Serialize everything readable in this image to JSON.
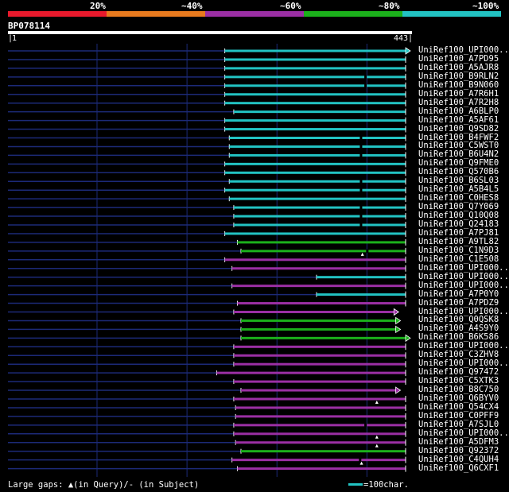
{
  "legend": {
    "labels": [
      "20%",
      "~40%",
      "~60%",
      "~80%",
      "~100%"
    ],
    "colors": [
      "#e8192c",
      "#e87a1e",
      "#9b2fa4",
      "#1bb01b",
      "#22c3c3"
    ]
  },
  "query": {
    "id": "BP078114",
    "start": "1",
    "end": "443",
    "length": 443
  },
  "colors": {
    "cyan": "#22c3c3",
    "purple": "#9b2fa4",
    "green": "#1bb01b",
    "navy": "#1c2a78",
    "grid": "#1c2a78"
  },
  "hits": [
    {
      "label": "UniRef100_UPI000...",
      "start": 242,
      "end": 443,
      "color": "cyan",
      "arrow": true
    },
    {
      "label": "UniRef100_A7PD95",
      "start": 242,
      "end": 443,
      "color": "cyan",
      "arrow": false
    },
    {
      "label": "UniRef100_A5AJR8",
      "start": 242,
      "end": 443,
      "color": "cyan",
      "arrow": false
    },
    {
      "label": "UniRef100_B9RLN2",
      "start": 242,
      "end": 443,
      "color": "cyan",
      "arrow": false,
      "gaps": [
        {
          "pos": 398,
          "type": "subject"
        }
      ]
    },
    {
      "label": "UniRef100_B9N060",
      "start": 242,
      "end": 443,
      "color": "cyan",
      "arrow": false,
      "gaps": [
        {
          "pos": 398,
          "type": "subject"
        }
      ]
    },
    {
      "label": "UniRef100_A7R6H1",
      "start": 242,
      "end": 443,
      "color": "cyan",
      "arrow": false
    },
    {
      "label": "UniRef100_A7R2H8",
      "start": 242,
      "end": 443,
      "color": "cyan",
      "arrow": false
    },
    {
      "label": "UniRef100_A6BLP0",
      "start": 252,
      "end": 443,
      "color": "cyan",
      "arrow": false
    },
    {
      "label": "UniRef100_A5AF61",
      "start": 242,
      "end": 443,
      "color": "cyan",
      "arrow": false
    },
    {
      "label": "UniRef100_Q9SD82",
      "start": 242,
      "end": 443,
      "color": "cyan",
      "arrow": false
    },
    {
      "label": "UniRef100_B4FWF2",
      "start": 247,
      "end": 443,
      "color": "cyan",
      "arrow": false,
      "gaps": [
        {
          "pos": 393,
          "type": "subject"
        }
      ]
    },
    {
      "label": "UniRef100_C5WST0",
      "start": 247,
      "end": 443,
      "color": "cyan",
      "arrow": false,
      "gaps": [
        {
          "pos": 393,
          "type": "subject"
        }
      ]
    },
    {
      "label": "UniRef100_B6U4N2",
      "start": 247,
      "end": 443,
      "color": "cyan",
      "arrow": false,
      "gaps": [
        {
          "pos": 393,
          "type": "subject"
        }
      ]
    },
    {
      "label": "UniRef100_Q9FME0",
      "start": 242,
      "end": 443,
      "color": "cyan",
      "arrow": false
    },
    {
      "label": "UniRef100_Q570B6",
      "start": 242,
      "end": 443,
      "color": "cyan",
      "arrow": false
    },
    {
      "label": "UniRef100_B6SL03",
      "start": 247,
      "end": 443,
      "color": "cyan",
      "arrow": false,
      "gaps": [
        {
          "pos": 393,
          "type": "subject"
        }
      ]
    },
    {
      "label": "UniRef100_A5B4L5",
      "start": 242,
      "end": 443,
      "color": "cyan",
      "arrow": false,
      "gaps": [
        {
          "pos": 393,
          "type": "subject"
        }
      ]
    },
    {
      "label": "UniRef100_C0HES8",
      "start": 247,
      "end": 443,
      "color": "cyan",
      "arrow": false
    },
    {
      "label": "UniRef100_Q7Y069",
      "start": 252,
      "end": 443,
      "color": "cyan",
      "arrow": false,
      "gaps": [
        {
          "pos": 393,
          "type": "subject"
        }
      ]
    },
    {
      "label": "UniRef100_Q10Q08",
      "start": 252,
      "end": 443,
      "color": "cyan",
      "arrow": false,
      "gaps": [
        {
          "pos": 393,
          "type": "subject"
        }
      ]
    },
    {
      "label": "UniRef100_Q24183",
      "start": 252,
      "end": 443,
      "color": "cyan",
      "arrow": false,
      "gaps": [
        {
          "pos": 393,
          "type": "subject"
        }
      ]
    },
    {
      "label": "UniRef100_A7PJ81",
      "start": 242,
      "end": 443,
      "color": "cyan",
      "arrow": false
    },
    {
      "label": "UniRef100_A9TL82",
      "start": 256,
      "end": 443,
      "color": "green",
      "arrow": false
    },
    {
      "label": "UniRef100_C1N9D3",
      "start": 260,
      "end": 443,
      "color": "green",
      "arrow": false,
      "gaps": [
        {
          "pos": 400,
          "type": "subject"
        },
        {
          "pos": 395,
          "type": "query"
        }
      ]
    },
    {
      "label": "UniRef100_C1E508",
      "start": 242,
      "end": 443,
      "color": "purple",
      "arrow": false
    },
    {
      "label": "UniRef100_UPI000...",
      "start": 250,
      "end": 443,
      "color": "purple",
      "arrow": false
    },
    {
      "label": "UniRef100_UPI000...",
      "start": 344,
      "end": 443,
      "color": "cyan",
      "arrow": false
    },
    {
      "label": "UniRef100_UPI000...",
      "start": 250,
      "end": 443,
      "color": "purple",
      "arrow": false
    },
    {
      "label": "UniRef100_A7P0Y0",
      "start": 344,
      "end": 443,
      "color": "cyan",
      "arrow": false
    },
    {
      "label": "UniRef100_A7PDZ9",
      "start": 256,
      "end": 443,
      "color": "purple",
      "arrow": false
    },
    {
      "label": "UniRef100_UPI000...",
      "start": 252,
      "end": 430,
      "color": "purple",
      "arrow": true
    },
    {
      "label": "UniRef100_Q0QSK8",
      "start": 260,
      "end": 432,
      "color": "green",
      "arrow": true
    },
    {
      "label": "UniRef100_A4S9Y0",
      "start": 260,
      "end": 432,
      "color": "green",
      "arrow": true
    },
    {
      "label": "UniRef100_B6K586",
      "start": 260,
      "end": 443,
      "color": "green",
      "arrow": true
    },
    {
      "label": "UniRef100_UPI000...",
      "start": 252,
      "end": 443,
      "color": "purple",
      "arrow": false
    },
    {
      "label": "UniRef100_C3ZHV8",
      "start": 252,
      "end": 443,
      "color": "purple",
      "arrow": false
    },
    {
      "label": "UniRef100_UPI000...",
      "start": 252,
      "end": 443,
      "color": "purple",
      "arrow": false
    },
    {
      "label": "UniRef100_Q97472",
      "start": 233,
      "end": 443,
      "color": "purple",
      "arrow": false
    },
    {
      "label": "UniRef100_C5XTK3",
      "start": 252,
      "end": 443,
      "color": "purple",
      "arrow": false
    },
    {
      "label": "UniRef100_B8C750",
      "start": 260,
      "end": 432,
      "color": "purple",
      "arrow": true
    },
    {
      "label": "UniRef100_Q6BYV0",
      "start": 252,
      "end": 443,
      "color": "purple",
      "arrow": false,
      "gaps": [
        {
          "pos": 411,
          "type": "query"
        }
      ]
    },
    {
      "label": "UniRef100_Q54CX4",
      "start": 254,
      "end": 443,
      "color": "purple",
      "arrow": false
    },
    {
      "label": "UniRef100_C0PFF9",
      "start": 254,
      "end": 443,
      "color": "purple",
      "arrow": false
    },
    {
      "label": "UniRef100_A7SJL0",
      "start": 252,
      "end": 443,
      "color": "purple",
      "arrow": false,
      "gaps": [
        {
          "pos": 398,
          "type": "subject"
        }
      ]
    },
    {
      "label": "UniRef100_UPI000...",
      "start": 252,
      "end": 443,
      "color": "purple",
      "arrow": false,
      "gaps": [
        {
          "pos": 411,
          "type": "query"
        }
      ]
    },
    {
      "label": "UniRef100_A5DFM3",
      "start": 254,
      "end": 443,
      "color": "purple",
      "arrow": false,
      "gaps": [
        {
          "pos": 411,
          "type": "query"
        }
      ]
    },
    {
      "label": "UniRef100_Q92372",
      "start": 260,
      "end": 443,
      "color": "green",
      "arrow": false
    },
    {
      "label": "UniRef100_C4QUH4",
      "start": 250,
      "end": 443,
      "color": "purple",
      "arrow": false,
      "gaps": [
        {
          "pos": 392,
          "type": "subject"
        },
        {
          "pos": 394,
          "type": "query"
        }
      ]
    },
    {
      "label": "UniRef100_Q6CXF1",
      "start": 256,
      "end": 443,
      "color": "purple",
      "arrow": false
    }
  ],
  "footer": {
    "text": "Large gaps: ▲(in Query)/- (in Subject)",
    "key_label": "=100char."
  }
}
